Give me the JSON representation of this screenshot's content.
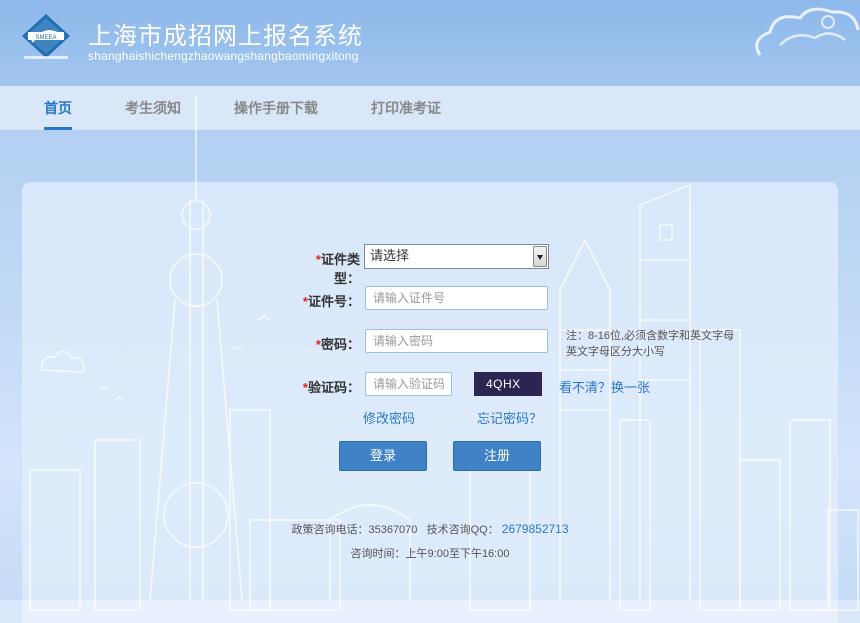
{
  "header": {
    "title": "上海市成招网上报名系统",
    "subtitle": "shanghaishichengzhaowangshangbaomingxitong",
    "logo_text": "SMEEA"
  },
  "nav": {
    "items": [
      {
        "label": "首页",
        "active": true
      },
      {
        "label": "考生须知",
        "active": false
      },
      {
        "label": "操作手册下载",
        "active": false
      },
      {
        "label": "打印准考证",
        "active": false
      }
    ]
  },
  "form": {
    "required_mark": "*",
    "id_type_label": "证件类型：",
    "id_type_value": "请选择",
    "id_number_label": "证件号：",
    "id_number_placeholder": "请输入证件号",
    "password_label": "密码：",
    "password_placeholder": "请输入密码",
    "password_hint_line1": "注：8-16位,必须含数字和英文字母",
    "password_hint_line2": "英文字母区分大小写",
    "captcha_label": "验证码：",
    "captcha_placeholder": "请输入验证码",
    "captcha_text": "4QHX",
    "refresh_captcha_link": "看不清？换一张",
    "change_password_link": "修改密码",
    "forgot_password_link": "忘记密码？",
    "login_button": "登录",
    "register_button": "注册"
  },
  "footer": {
    "policy_phone_label": "政策咨询电话：35367070",
    "tech_qq_label": "技术咨询QQ：",
    "tech_qq_number": "2679852713",
    "hours": "咨询时间：上午9:00至下午16:00"
  },
  "colors": {
    "accent": "#2878c8",
    "button": "#3f82c5",
    "required": "#d9281f",
    "captcha_bg": "#2c2552"
  }
}
